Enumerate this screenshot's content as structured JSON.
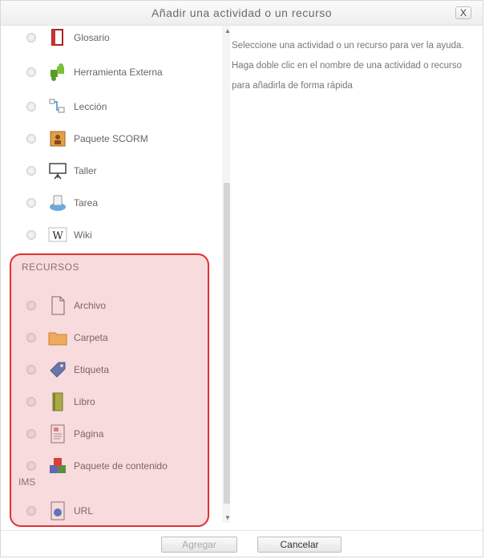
{
  "dialog": {
    "title": "Añadir una actividad o un recurso",
    "close_label": "X"
  },
  "activities": [
    {
      "label": "Glosario",
      "icon": "glossary-book-icon"
    },
    {
      "label": "Herramienta Externa",
      "icon": "puzzle-icon"
    },
    {
      "label": "Lección",
      "icon": "lesson-icon"
    },
    {
      "label": "Paquete SCORM",
      "icon": "scorm-package-icon"
    },
    {
      "label": "Taller",
      "icon": "workshop-board-icon"
    },
    {
      "label": "Tarea",
      "icon": "assignment-icon"
    },
    {
      "label": "Wiki",
      "icon": "wiki-icon"
    }
  ],
  "resources": {
    "section_title": "RECURSOS",
    "items": [
      {
        "label": "Archivo",
        "icon": "file-icon"
      },
      {
        "label": "Carpeta",
        "icon": "folder-icon"
      },
      {
        "label": "Etiqueta",
        "icon": "label-icon"
      },
      {
        "label": "Libro",
        "icon": "book-icon"
      },
      {
        "label": "Página",
        "icon": "page-icon"
      },
      {
        "label": "Paquete de contenido",
        "icon": "content-package-icon"
      },
      {
        "label": "URL",
        "icon": "url-icon"
      }
    ],
    "ims_label": "IMS"
  },
  "help": {
    "text": "Seleccione una actividad o un recurso para ver la ayuda. Haga doble clic en el nombre de una actividad o recurso para añadirla de forma rápida"
  },
  "footer": {
    "add_label": "Agregar",
    "cancel_label": "Cancelar"
  },
  "colors": {
    "highlight_border": "#e03232",
    "highlight_fill": "#f2c9cc"
  }
}
